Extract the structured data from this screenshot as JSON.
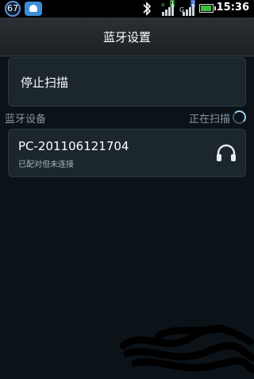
{
  "statusbar": {
    "notification_count": "67",
    "signal_indicator_1": "1",
    "signal_indicator_1_letter": "G",
    "signal_indicator_2": "2",
    "time": "15:36"
  },
  "header": {
    "title": "蓝牙设置"
  },
  "stop_scan": {
    "label": "停止扫描"
  },
  "section": {
    "title": "蓝牙设备",
    "status": "正在扫描"
  },
  "device": {
    "name": "PC-201106121704",
    "status": "已配对但未连接"
  },
  "icons": {
    "notification_badge": "badge",
    "chat": "chat-icon",
    "bluetooth": "bluetooth-icon",
    "battery": "battery-icon",
    "headphone": "headphone-icon",
    "spinner": "scanning-spinner-icon"
  },
  "colors": {
    "accent": "#5b8fd6",
    "battery": "#3cbf3c",
    "background": "#0b1218"
  }
}
